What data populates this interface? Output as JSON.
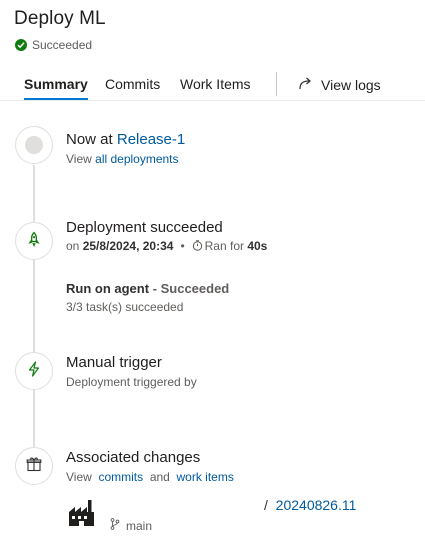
{
  "header": {
    "title": "Deploy ML",
    "status": "Succeeded"
  },
  "tabs": {
    "summary": "Summary",
    "commits": "Commits",
    "work_items": "Work Items",
    "view_logs": "View logs"
  },
  "timeline": {
    "release": {
      "prefix": "Now at ",
      "release_name": "Release-1",
      "view_prefix": "View ",
      "view_link": "all deployments"
    },
    "deployment": {
      "title": "Deployment succeeded",
      "on": "on ",
      "date": "25/8/2024, 20:34",
      "ran_prefix": "Ran for ",
      "duration": "40s",
      "agent_label": "Run on agent",
      "agent_status": " - Succeeded",
      "tasks": "3/3 task(s) succeeded"
    },
    "trigger": {
      "title": "Manual trigger",
      "sub": "Deployment triggered by"
    },
    "changes": {
      "title": "Associated changes",
      "view": "View",
      "commits_link": "commits",
      "and": "and",
      "work_items_link": "work items",
      "build_sep": "/",
      "build_number": "20240826.11",
      "branch": "main"
    }
  },
  "colors": {
    "accent": "#0078d4",
    "success": "#107c10",
    "link": "#005a9e"
  }
}
